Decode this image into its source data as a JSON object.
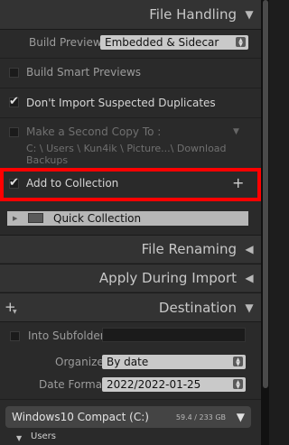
{
  "file_handling": {
    "title": "File Handling",
    "build_previews_label": "Build Previews",
    "build_previews_value": "Embedded & Sidecar",
    "build_smart_previews_label": "Build Smart Previews",
    "dont_import_duplicates_label": "Don't Import Suspected Duplicates",
    "second_copy_label": "Make a Second Copy To :",
    "second_copy_path": "C: \\ Users \\ Kun4ik \\ Picture...\\ Download Backups",
    "add_to_collection_label": "Add to Collection",
    "quick_collection_label": "Quick Collection"
  },
  "file_renaming": {
    "title": "File Renaming"
  },
  "apply_during_import": {
    "title": "Apply During Import"
  },
  "destination": {
    "title": "Destination",
    "into_subfolder_label": "Into Subfolder",
    "organize_label": "Organize",
    "organize_value": "By date",
    "date_format_label": "Date Format",
    "date_format_value": "2022/2022-01-25",
    "volume_name": "Windows10 Compact (C:)",
    "volume_size": "59.4 / 233 GB",
    "users_folder": "Users"
  },
  "icons": {
    "expanded": "triangle-down",
    "collapsed": "triangle-left",
    "add": "plus"
  },
  "colors": {
    "highlight": "#ff0000",
    "panel": "#2a2a2a",
    "header": "#333333"
  }
}
